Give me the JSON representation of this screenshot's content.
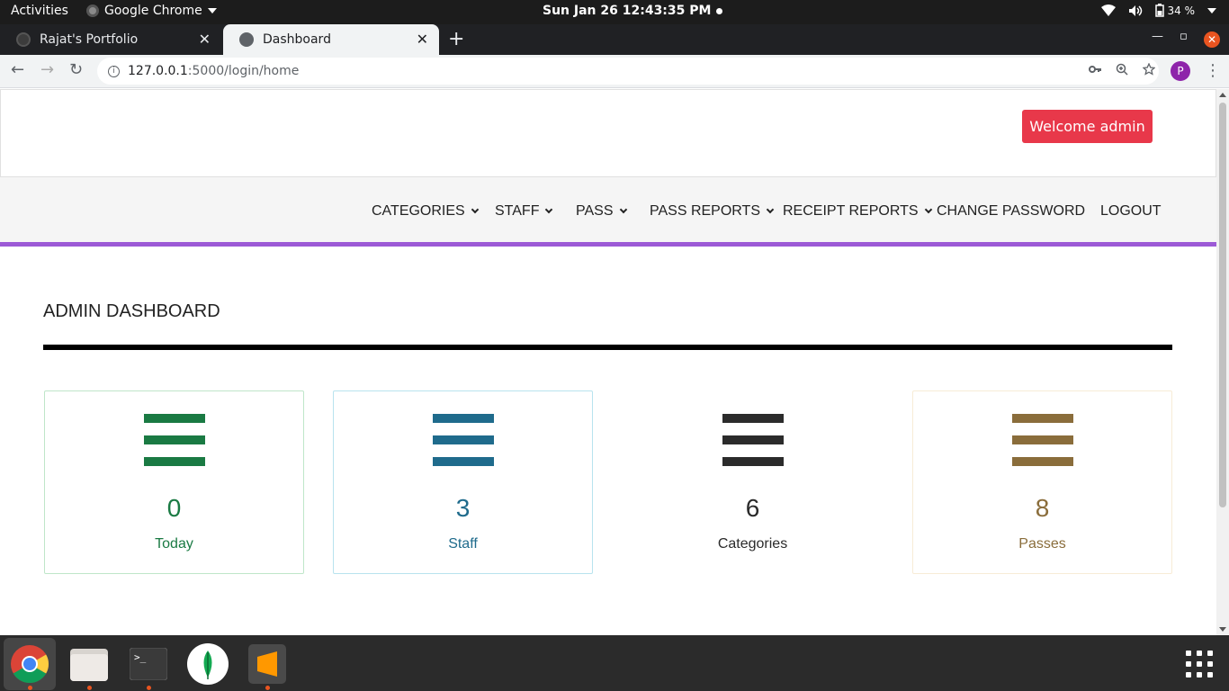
{
  "system": {
    "activities": "Activities",
    "app_name": "Google Chrome",
    "clock": "Sun Jan 26  12:43:35 PM",
    "battery": "34 %"
  },
  "browser": {
    "tabs": [
      {
        "label": "Rajat's Portfolio",
        "active": false
      },
      {
        "label": "Dashboard",
        "active": true
      }
    ],
    "url_host": "127.0.0.1",
    "url_path": ":5000/login/home",
    "profile_initial": "P"
  },
  "header": {
    "welcome_button": "Welcome admin"
  },
  "navbar": {
    "items": [
      {
        "label": "CATEGORIES",
        "dropdown": true
      },
      {
        "label": "STAFF",
        "dropdown": true
      },
      {
        "label": "PASS",
        "dropdown": true
      },
      {
        "label": "PASS REPORTS",
        "dropdown": true
      },
      {
        "label": "RECEIPT REPORTS",
        "dropdown": true
      },
      {
        "label": "CHANGE PASSWORD",
        "dropdown": false
      },
      {
        "label": "LOGOUT",
        "dropdown": false
      }
    ]
  },
  "dashboard": {
    "title": "ADMIN DASHBOARD",
    "cards": [
      {
        "value": "0",
        "label": "Today",
        "color": "#1a7a43",
        "border": "#bfe6c9"
      },
      {
        "value": "3",
        "label": "Staff",
        "color": "#1f6b8c",
        "border": "#b8e3ee"
      },
      {
        "value": "6",
        "label": "Categories",
        "color": "#2b2b2b",
        "border": "transparent"
      },
      {
        "value": "8",
        "label": "Passes",
        "color": "#8a6d3b",
        "border": "#f7ecd6"
      }
    ]
  },
  "dock": {
    "apps": [
      "chrome-icon",
      "files-icon",
      "terminal-icon",
      "mongodb-icon",
      "sublime-text-icon"
    ]
  }
}
